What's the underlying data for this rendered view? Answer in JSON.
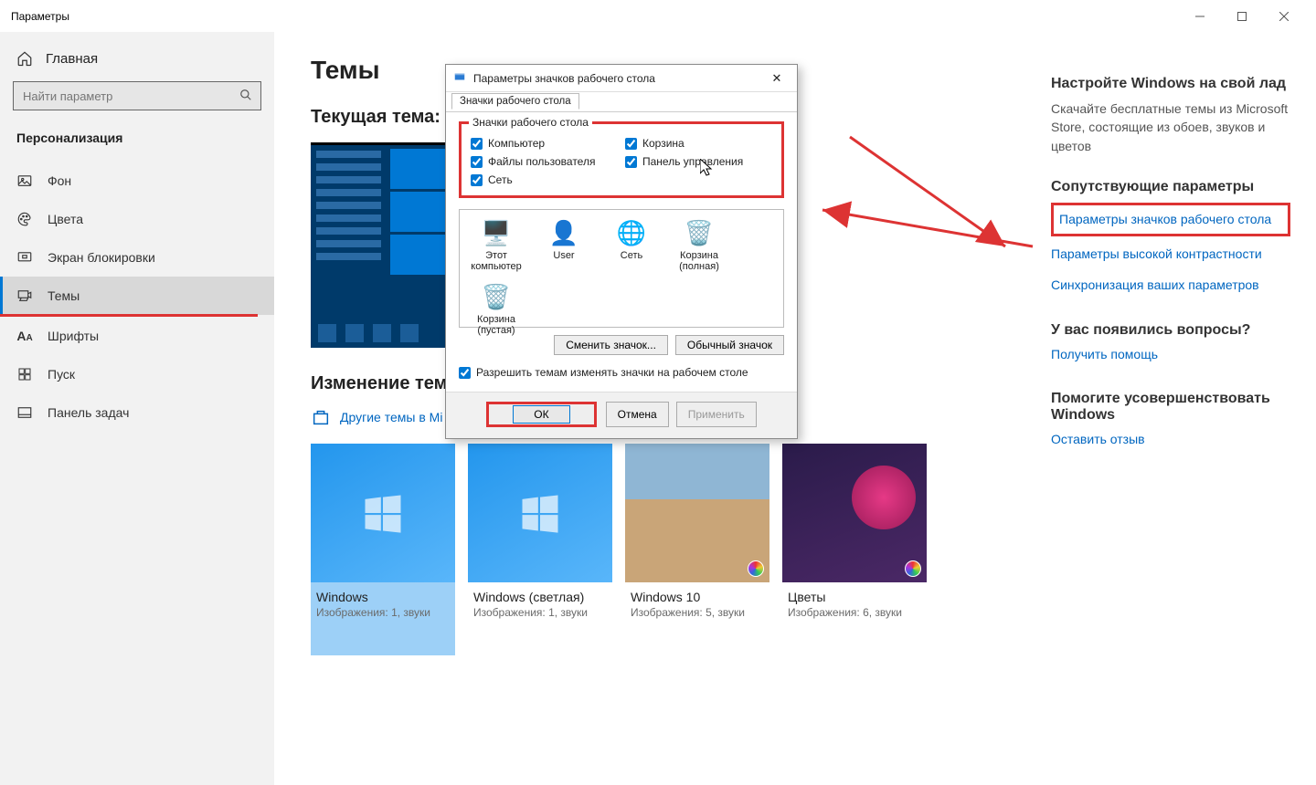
{
  "titlebar": {
    "app_title": "Параметры"
  },
  "sidebar": {
    "home": "Главная",
    "search_placeholder": "Найти параметр",
    "section": "Персонализация",
    "items": [
      {
        "label": "Фон"
      },
      {
        "label": "Цвета"
      },
      {
        "label": "Экран блокировки"
      },
      {
        "label": "Темы",
        "selected": true
      },
      {
        "label": "Шрифты"
      },
      {
        "label": "Пуск"
      },
      {
        "label": "Панель задач"
      }
    ]
  },
  "main": {
    "title": "Темы",
    "current_theme_label": "Текущая тема: W",
    "change_theme_label": "Изменение темы",
    "store_link": "Другие темы в Mi",
    "themes": [
      {
        "name": "Windows",
        "meta": "Изображения: 1, звуки",
        "selected": true,
        "kind": "blue"
      },
      {
        "name": "Windows (светлая)",
        "meta": "Изображения: 1, звуки",
        "kind": "blue"
      },
      {
        "name": "Windows 10",
        "meta": "Изображения: 5, звуки",
        "kind": "beach"
      },
      {
        "name": "Цветы",
        "meta": "Изображения: 6, звуки",
        "kind": "flower"
      }
    ]
  },
  "right": {
    "h1": "Настройте Windows на свой лад",
    "p1": "Скачайте бесплатные темы из Microsoft Store, состоящие из обоев, звуков и цветов",
    "h2": "Сопутствующие параметры",
    "link_desktop_icons": "Параметры значков рабочего стола",
    "link_high_contrast": "Параметры высокой контрастности",
    "link_sync": "Синхронизация ваших параметров",
    "h3": "У вас появились вопросы?",
    "link_help": "Получить помощь",
    "h4": "Помогите усовершенствовать Windows",
    "link_feedback": "Оставить отзыв"
  },
  "dialog": {
    "title": "Параметры значков рабочего стола",
    "tab": "Значки рабочего стола",
    "group_label": "Значки рабочего стола",
    "chk_computer": "Компьютер",
    "chk_recycle": "Корзина",
    "chk_userfiles": "Файлы пользователя",
    "chk_cpanel": "Панель управления",
    "chk_network": "Сеть",
    "icons": [
      {
        "label1": "Этот",
        "label2": "компьютер",
        "glyph": "🖥️"
      },
      {
        "label1": "User",
        "label2": "",
        "glyph": "👤"
      },
      {
        "label1": "Сеть",
        "label2": "",
        "glyph": "🌐"
      },
      {
        "label1": "Корзина",
        "label2": "(полная)",
        "glyph": "🗑️"
      },
      {
        "label1": "Корзина",
        "label2": "(пустая)",
        "glyph": "🗑️"
      }
    ],
    "btn_change": "Сменить значок...",
    "btn_default": "Обычный значок",
    "allow_themes": "Разрешить темам изменять значки на рабочем столе",
    "btn_ok": "ОК",
    "btn_cancel": "Отмена",
    "btn_apply": "Применить"
  }
}
